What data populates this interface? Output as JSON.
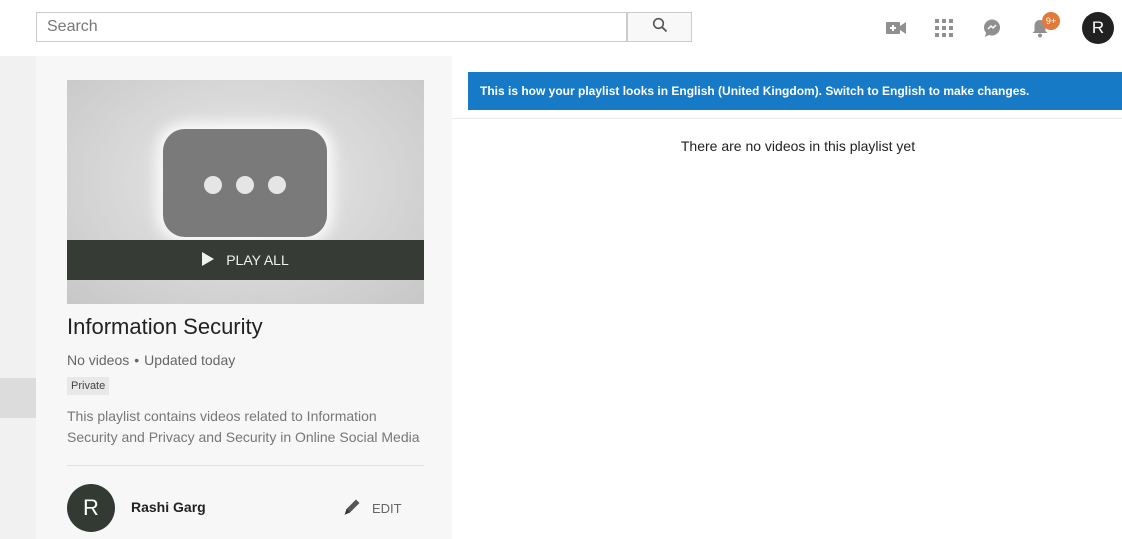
{
  "header": {
    "search_placeholder": "Search",
    "notification_count": "9+",
    "avatar_initial": "R",
    "icons": [
      "search-icon",
      "upload-video-icon",
      "apps-grid-icon",
      "messages-icon",
      "notifications-bell-icon"
    ]
  },
  "playlist": {
    "play_all_label": "PLAY ALL",
    "title": "Information Security",
    "video_count": "No videos",
    "separator": "•",
    "updated": "Updated today",
    "privacy": "Private",
    "description": "This playlist contains videos related to Information Security and Privacy and Security in Online Social Media",
    "owner_initial": "R",
    "owner_name": "Rashi Garg",
    "edit_label": "EDIT"
  },
  "main": {
    "language_banner": "This is how your playlist looks in English (United Kingdom). Switch to English to make changes.",
    "empty_message": "There are no videos in this playlist yet"
  },
  "colors": {
    "banner": "#167ac6",
    "badge": "#e07b3c",
    "play_bar": "#363b36"
  }
}
